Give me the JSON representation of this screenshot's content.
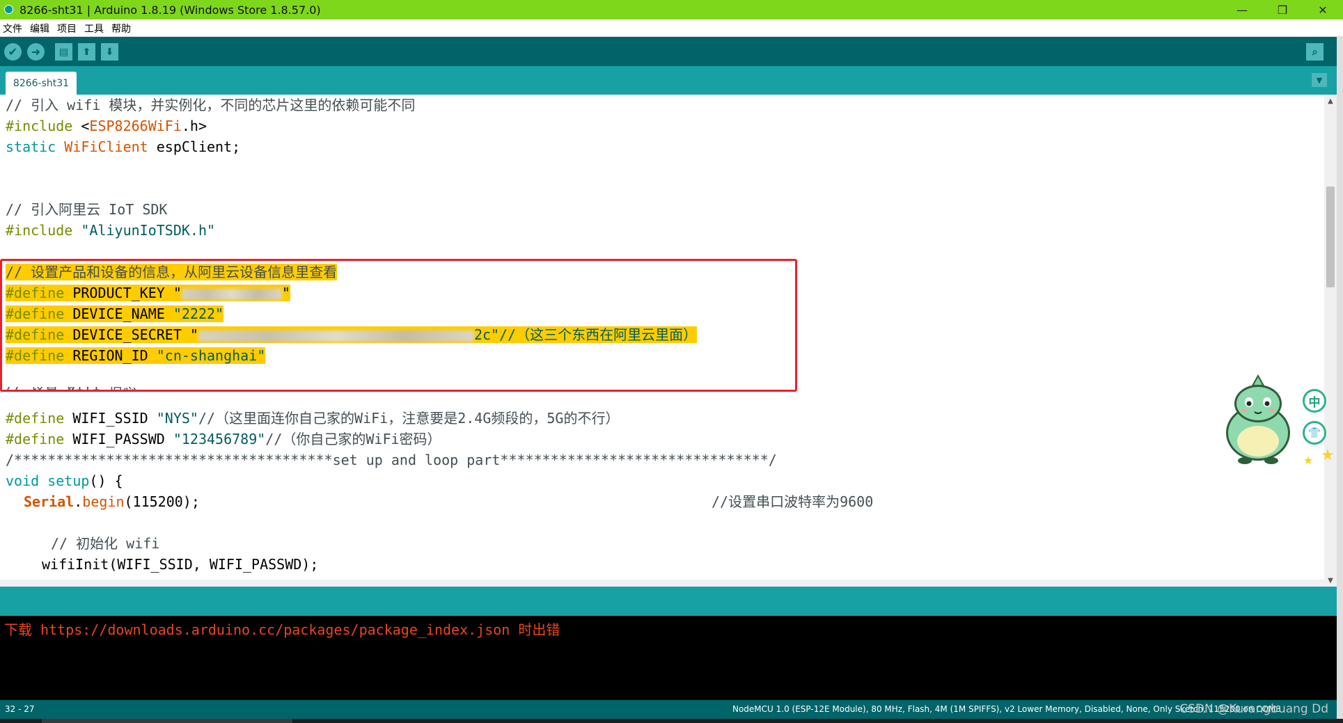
{
  "window": {
    "title": "8266-sht31 | Arduino 1.8.19 (Windows Store 1.8.57.0)",
    "minimize_glyph": "—",
    "maximize_glyph": "❒",
    "close_glyph": "✕"
  },
  "menu": {
    "items": [
      "文件",
      "编辑",
      "项目",
      "工具",
      "帮助"
    ]
  },
  "toolbar": {
    "verify_icon": "check-icon",
    "upload_icon": "arrow-right-icon",
    "new_icon": "new-file-icon",
    "open_icon": "arrow-up-icon",
    "save_icon": "arrow-down-icon",
    "serial_monitor_icon": "magnifier-icon",
    "verify_glyph": "✔",
    "upload_glyph": "➜",
    "new_glyph": "▤",
    "open_glyph": "⬆",
    "save_glyph": "⬇",
    "serial_glyph": "⌕"
  },
  "tabs": {
    "active": "8266-sht31",
    "menu_glyph": "▼"
  },
  "code": {
    "l1": "// 引入 wifi 模块，并实例化，不同的芯片这里的依赖可能不同",
    "l2_directive": "#include",
    "l2_open": " <",
    "l2_lib": "ESP8266WiFi",
    "l2_close": ".h>",
    "l3_static": "static",
    "l3_type": "WiFiClient",
    "l3_rest": " espClient;",
    "l6": "// 引入阿里云 IoT SDK",
    "l7_directive": "#include",
    "l7_string": " \"AliyunIoTSDK.h\"",
    "l9": "// 设置产品和设备的信息，从阿里云设备信息里查看",
    "l10_directive": "#define",
    "l10_name": " PRODUCT_KEY \"",
    "l10_tail": "\"",
    "l11_directive": "#define",
    "l11_name": " DEVICE_NAME ",
    "l11_value": "\"2222\"",
    "l12_directive": "#define",
    "l12_name": " DEVICE_SECRET \"",
    "l12_tail": "2c\"//（这三个东西在阿里云里面）",
    "l13_directive": "#define",
    "l13_name": " REGION_ID ",
    "l13_value": "\"cn-shanghai\"",
    "l14": "// 设置 wifi 信息",
    "l15_directive": "#define",
    "l15_name": " WIFI_SSID ",
    "l15_value": "\"NYS\"",
    "l15_comment": "//（这里面连你自己家的WiFi，注意要是2.4G频段的，5G的不行）",
    "l16_directive": "#define",
    "l16_name": " WIFI_PASSWD ",
    "l16_value": "\"123456789\"",
    "l16_comment": "//（你自己家的WiFi密码）",
    "l17": "/**************************************set up and loop part********************************/",
    "l18_void": "void",
    "l18_func": " setup",
    "l18_rest": "() {",
    "l19_serial": "Serial",
    "l19_dot": ".",
    "l19_begin": "begin",
    "l19_args": "(115200);",
    "l19_comment": "//设置串口波特率为9600",
    "l21": "// 初始化 wifi",
    "l22": "wifiInit(WIFI_SSID, WIFI_PASSWD);"
  },
  "console": {
    "message": "下载 https://downloads.arduino.cc/packages/package_index.json 时出错"
  },
  "status": {
    "position": "32 - 27",
    "board": "NodeMCU 1.0 (ESP-12E Module), 80 MHz, Flash, 4M (1M SPIFFS), v2 Lower Memory, Disabled, None, Only Sketch, 115200 on COM3",
    "watermark": "CSDN @Kurangbuang Dd"
  },
  "ime": {
    "chinese_label": "中"
  },
  "colors": {
    "titlebar": "#7ed71b",
    "toolbar": "#006468",
    "tabbar": "#17a1a5",
    "highlight": "#ffcc00",
    "annotation_box": "#e8222a",
    "console_error": "#e8471f"
  }
}
